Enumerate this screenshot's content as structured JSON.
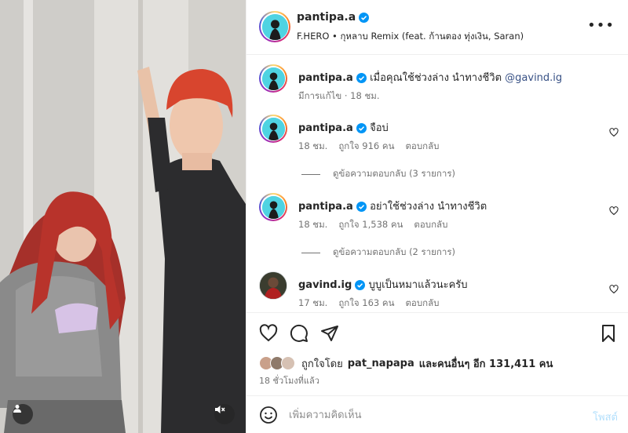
{
  "post": {
    "username": "pantipa.a",
    "audio": "F.HERO • กุหลาบ Remix (feat. ก้านตอง ทุ่งเงิน, Saran)",
    "more_label": "•••",
    "caption": {
      "username": "pantipa.a",
      "text": "เมื่อคุณใช้ช่วงล่าง นำทางชีวิต",
      "mention": "@gavind.ig",
      "edited": "มีการแก้ไข · 18 ชม."
    }
  },
  "comments": [
    {
      "username": "pantipa.a",
      "text": "จือบ่",
      "time": "18 ชม.",
      "likes": "ถูกใจ 916 คน",
      "reply": "ตอบกลับ",
      "view_replies": "ดูข้อความตอบกลับ (3 รายการ)"
    },
    {
      "username": "pantipa.a",
      "text": "อย่าใช้ช่วงล่าง นำทางชีวิต",
      "time": "18 ชม.",
      "likes": "ถูกใจ 1,538 คน",
      "reply": "ตอบกลับ",
      "view_replies": "ดูข้อความตอบกลับ (2 รายการ)"
    },
    {
      "username": "gavind.ig",
      "text": "บูบูเป็นหมาแล้วนะครับ",
      "time": "17 ชม.",
      "likes": "ถูกใจ 163 คน",
      "reply": "ตอบกลับ"
    }
  ],
  "likes": {
    "prefix": "ถูกใจโดย",
    "user": "pat_napapa",
    "suffix": "และคนอื่นๆ อีก 131,411 คน"
  },
  "timestamp": "18 ชั่วโมงที่แล้ว",
  "composer": {
    "placeholder": "เพิ่มความคิดเห็น",
    "post_label": "โพสต์"
  },
  "icons": {
    "like": "heart-icon",
    "comment": "comment-icon",
    "share": "send-icon",
    "save": "bookmark-icon",
    "emoji": "emoji-icon",
    "user_tag": "user-icon",
    "mute": "speaker-muted-icon"
  },
  "colors": {
    "verified": "#0095f6",
    "mention": "#385185",
    "muted_text": "#737373",
    "post_disabled": "#b2dffc"
  }
}
